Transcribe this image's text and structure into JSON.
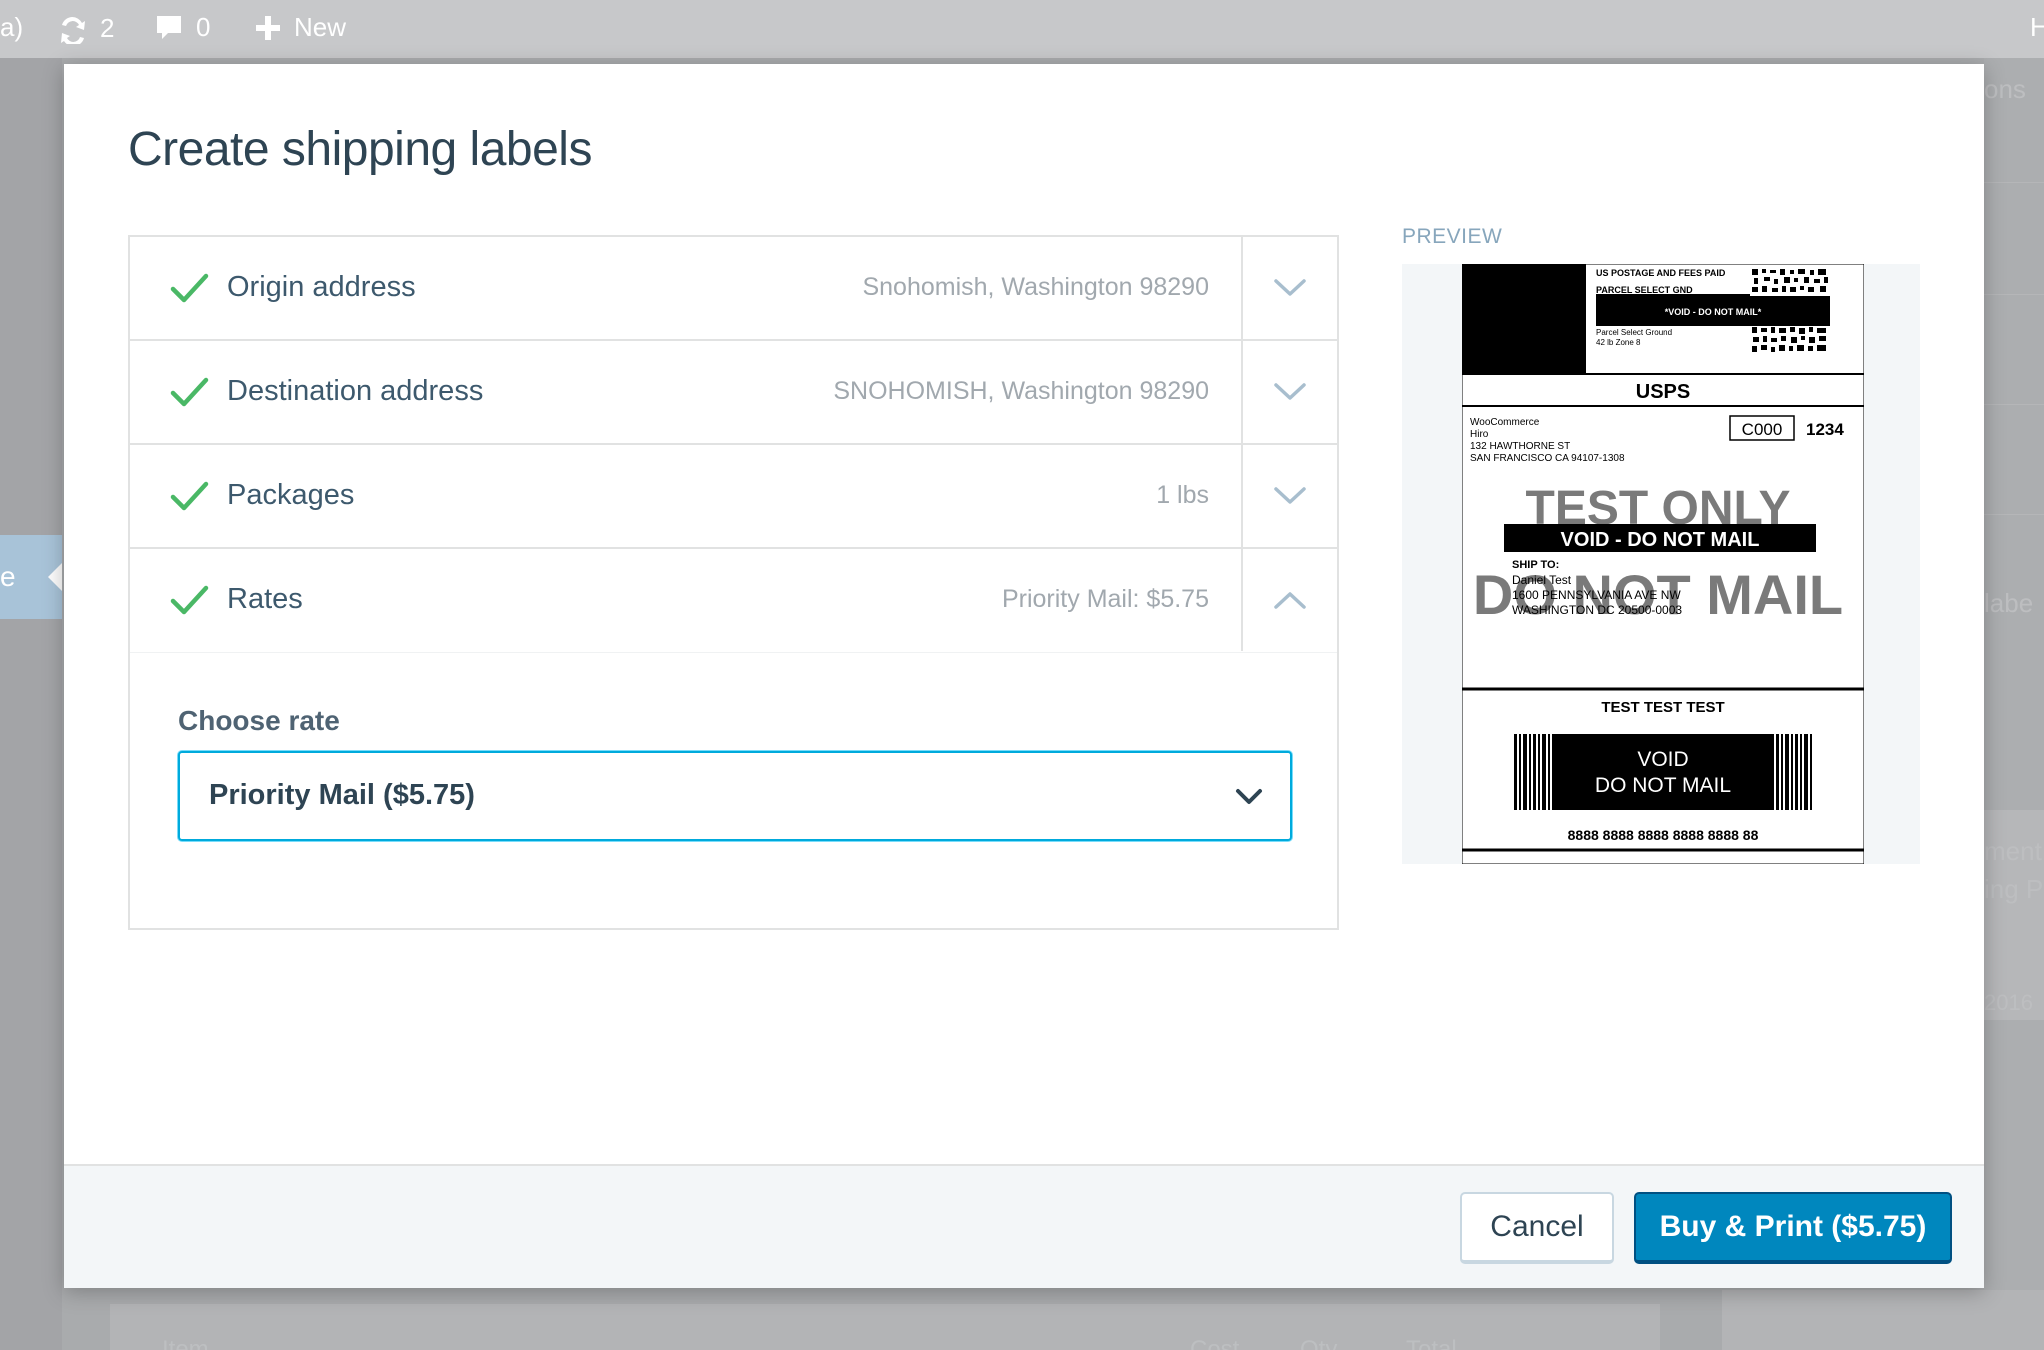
{
  "admin_bar": {
    "site_fragment": "a)",
    "updates_count": "2",
    "comments_count": "0",
    "new_label": "New",
    "right_fragment": "H"
  },
  "background": {
    "sidebar_fragment": "e",
    "right_fragments": [
      "ons",
      "labe",
      "ment",
      "ing P",
      "2016"
    ],
    "bottom_headers": [
      "Item",
      "Cost",
      "Qty",
      "Total"
    ]
  },
  "modal": {
    "title": "Create shipping labels",
    "steps": [
      {
        "title": "Origin address",
        "summary": "Snohomish, Washington 98290",
        "status": "complete",
        "expanded": false
      },
      {
        "title": "Destination address",
        "summary": "SNOHOMISH, Washington 98290",
        "status": "complete",
        "expanded": false
      },
      {
        "title": "Packages",
        "summary": "1 lbs",
        "status": "complete",
        "expanded": false
      },
      {
        "title": "Rates",
        "summary": "Priority Mail: $5.75",
        "status": "complete",
        "expanded": true
      }
    ],
    "rates": {
      "label": "Choose rate",
      "selected": "Priority Mail ($5.75)"
    },
    "preview": {
      "heading": "PREVIEW",
      "postage_line1": "US POSTAGE AND FEES PAID",
      "postage_line2": "PARCEL SELECT GND",
      "void_small": "*VOID - DO NOT MAIL*",
      "postage_line3": "Parcel Select Ground",
      "postage_line4": "42 lb Zone 8",
      "carrier": "USPS",
      "from_lines": [
        "WooCommerce",
        "Hiro",
        "132 HAWTHORNE ST",
        "SAN FRANCISCO CA 94107-1308"
      ],
      "box_code": "C000",
      "box_number": "1234",
      "watermark_line1": "TEST ONLY",
      "watermark_line2": "DO NOT MAIL",
      "void_banner": "VOID - DO NOT MAIL",
      "ship_to_label": "SHIP TO:",
      "to_lines": [
        "Daniel Test",
        "1600 PENNSYLVANIA AVE NW",
        "WASHINGTON DC 20500-0003"
      ],
      "test_line": "TEST TEST TEST",
      "barcode_void1": "VOID",
      "barcode_void2": "DO NOT MAIL",
      "tracking": "8888 8888 8888 8888 8888 88"
    },
    "footer": {
      "cancel_label": "Cancel",
      "buy_label": "Buy & Print ($5.75)"
    }
  },
  "colors": {
    "check_green": "#4ab866",
    "primary_blue": "#0087be",
    "focus_blue": "#00aadc",
    "text_dark": "#2e4453"
  }
}
